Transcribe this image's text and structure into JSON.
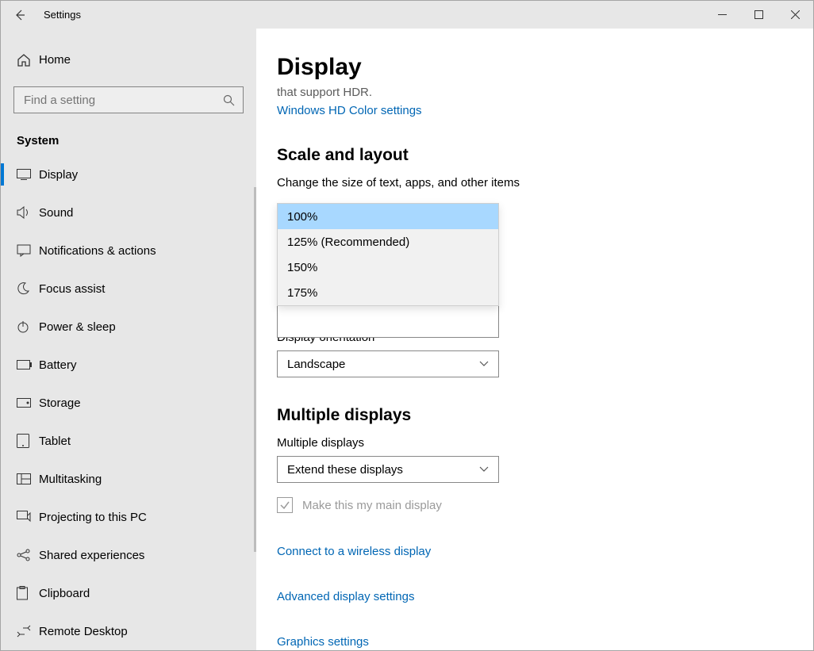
{
  "window": {
    "title": "Settings"
  },
  "sidebar": {
    "home": "Home",
    "search_placeholder": "Find a setting",
    "section": "System",
    "items": [
      {
        "label": "Display"
      },
      {
        "label": "Sound"
      },
      {
        "label": "Notifications & actions"
      },
      {
        "label": "Focus assist"
      },
      {
        "label": "Power & sleep"
      },
      {
        "label": "Battery"
      },
      {
        "label": "Storage"
      },
      {
        "label": "Tablet"
      },
      {
        "label": "Multitasking"
      },
      {
        "label": "Projecting to this PC"
      },
      {
        "label": "Shared experiences"
      },
      {
        "label": "Clipboard"
      },
      {
        "label": "Remote Desktop"
      }
    ]
  },
  "main": {
    "title": "Display",
    "hdr_line": "that support HDR.",
    "hdr_link": "Windows HD Color settings",
    "scale": {
      "heading": "Scale and layout",
      "size_label": "Change the size of text, apps, and other items",
      "options": [
        "100%",
        "125% (Recommended)",
        "150%",
        "175%"
      ],
      "selected": "100%",
      "orientation_label": "Display orientation",
      "orientation_value": "Landscape"
    },
    "multi": {
      "heading": "Multiple displays",
      "label": "Multiple displays",
      "value": "Extend these displays",
      "main_display_checkbox": "Make this my main display"
    },
    "links": {
      "wireless": "Connect to a wireless display",
      "advanced": "Advanced display settings",
      "graphics": "Graphics settings"
    }
  }
}
